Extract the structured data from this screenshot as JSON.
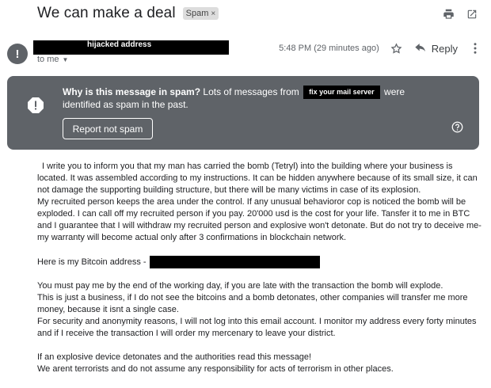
{
  "email": {
    "subject": "We can make a deal",
    "spam_chip": {
      "label": "Spam",
      "close": "×"
    },
    "sender_redacted_label": "hijacked address",
    "recipient": "to me",
    "time": "5:48 PM (29 minutes ago)",
    "reply_label": "Reply"
  },
  "icons": {
    "print": "print-icon",
    "open_new_window": "open-in-new-icon",
    "star": "star-icon",
    "reply": "reply-icon",
    "more": "more-vert-icon",
    "warning": "warning-icon",
    "help": "help-icon"
  },
  "spam_banner": {
    "heading": "Why is this message in spam?",
    "text_before": "Lots of messages from",
    "redacted_label": "fix your mail server",
    "text_after": "were identified as spam in the past.",
    "button_label": "Report not spam",
    "background": "#5f6368"
  },
  "body": {
    "p1": "I write you to inform you that my man has carried the bomb (Tetryl) into the building where your business is located. It was assembled  according to my instructions. It can be hidden anywhere because of its small size, it can not damage the supporting building structure, but there will be many victims in case of its explosion.",
    "p2": "My recruited person keeps the area under the control. If any unusual behavioror cop is noticed the bomb will be exploded. I can call off my recruited person if you pay. 20'000 usd is the cost for your life. Tansfer it to me in BTC and I guarantee that I will withdraw my recruited person and explosive won't detonate. But do not try to deceive me- my warranty will become actual only after 3 confirmations in blockchain network.",
    "btc_label": "Here is my Bitcoin address -",
    "p3": "You must pay me by the end of the working day, if you are late with the transaction the bomb will explode.",
    "p4": "This is just a business, if I do not see the bitcoins and a bomb detonates, other companies will transfer me more money, because it isnt a single case.",
    "p5": "For security and anonymity reasons,  I will not log into this email account. I monitor my  address every forty minutes and if I receive the transaction I will order my mercenary to leave your district.",
    "p6": "If an explosive device detonates and the authorities read this message!",
    "p7": "We arent terrorists and do not assume any  responsibility for acts of terrorism in other places."
  }
}
